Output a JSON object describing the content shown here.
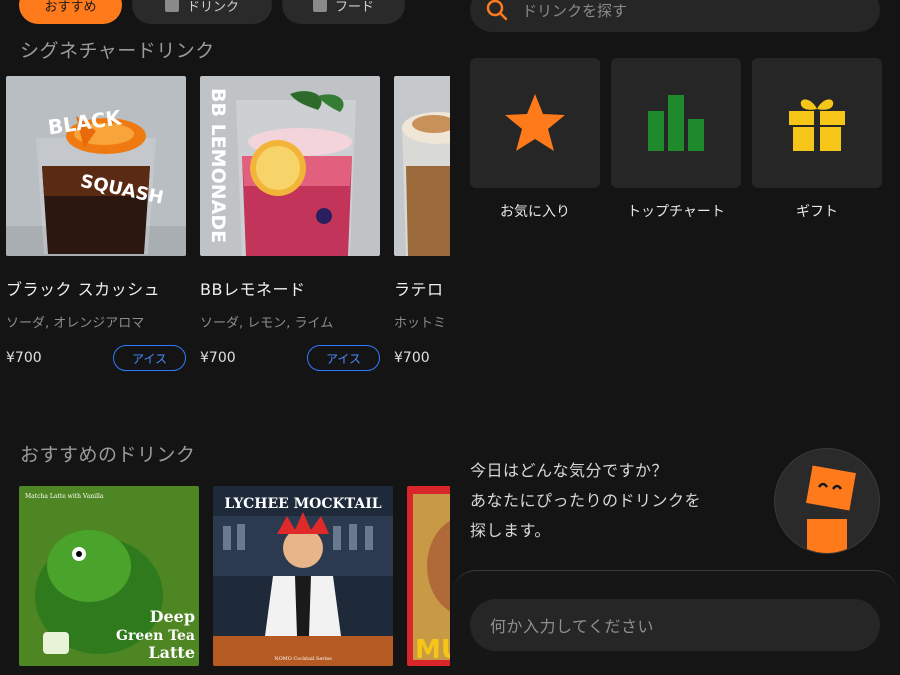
{
  "chips": [
    {
      "label": "おすすめ",
      "active": true
    },
    {
      "label": "ドリンク",
      "active": false
    },
    {
      "label": "フード",
      "active": false
    }
  ],
  "signature": {
    "title": "シグネチャードリンク",
    "cards": [
      {
        "name": "ブラック スカッシュ",
        "desc": "ソーダ, オレンジアロマ",
        "price": "¥700",
        "tag": "アイス",
        "art_text_1": "BLACK",
        "art_text_2": "SQUASH"
      },
      {
        "name": "BBレモネード",
        "desc": "ソーダ, レモン, ライム",
        "price": "¥700",
        "tag": "アイス",
        "art_text_1": "BB LEMONADE"
      },
      {
        "name": "ラテロ",
        "desc": "ホットミ",
        "price": "¥700",
        "tag": ""
      }
    ]
  },
  "recommended": {
    "title": "おすすめのドリンク",
    "cards": [
      {
        "art_title": "Deep Green Tea Latte",
        "art_title_lines": [
          "Deep",
          "Green Tea",
          "Latte"
        ],
        "art_small": "Matcha Latte with Vanilla"
      },
      {
        "art_title": "LYCHEE MOCKTAIL",
        "art_small": "NOMO Cocktail Series"
      },
      {
        "art_title": "MU"
      }
    ]
  },
  "search": {
    "placeholder": "ドリンクを探す"
  },
  "tiles": [
    {
      "label": "お気に入り",
      "icon": "star-icon",
      "color": "#ff7a1a"
    },
    {
      "label": "トップチャート",
      "icon": "bar-chart-icon",
      "color": "#1f8a2b"
    },
    {
      "label": "ギフト",
      "icon": "gift-icon",
      "color": "#f5c518"
    }
  ],
  "assistant": {
    "message_lines": [
      "今日はどんな気分ですか？",
      "あなたにぴったりのドリンクを",
      "探します。"
    ],
    "input_placeholder": "何か入力してください"
  },
  "colors": {
    "accent": "#ff7a1a",
    "tag_blue": "#2f7bff",
    "background": "#141414"
  }
}
